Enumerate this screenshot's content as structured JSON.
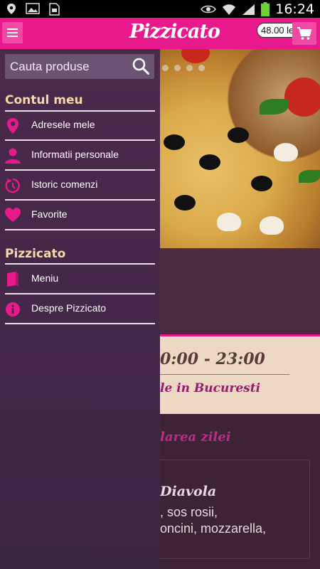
{
  "status_bar": {
    "time": "16:24"
  },
  "header": {
    "logo": "Pizzicato",
    "cart_total": "48.00 lei"
  },
  "drawer": {
    "search": {
      "placeholder": "Cauta produse"
    },
    "sections": [
      {
        "title": "Contul meu",
        "items": [
          {
            "label": "Adresele mele",
            "icon": "map-pin-icon"
          },
          {
            "label": "Informatii personale",
            "icon": "person-icon"
          },
          {
            "label": "Istoric comenzi",
            "icon": "history-icon"
          },
          {
            "label": "Favorite",
            "icon": "heart-icon"
          }
        ]
      },
      {
        "title": "Pizzicato",
        "items": [
          {
            "label": "Meniu",
            "icon": "book-icon"
          },
          {
            "label": "Despre Pizzicato",
            "icon": "info-icon"
          }
        ]
      }
    ]
  },
  "background": {
    "hours": "0:00 - 23:00",
    "delivery": "le in Bucuresti",
    "offer_title": "larea zilei",
    "offer_name": "Diavola",
    "offer_desc": [
      ", sos rosii,",
      "oncini, mozzarella,"
    ]
  },
  "colors": {
    "brand": "#e8198b",
    "drawer": "#442848",
    "accent_text": "#f7d7a8"
  }
}
